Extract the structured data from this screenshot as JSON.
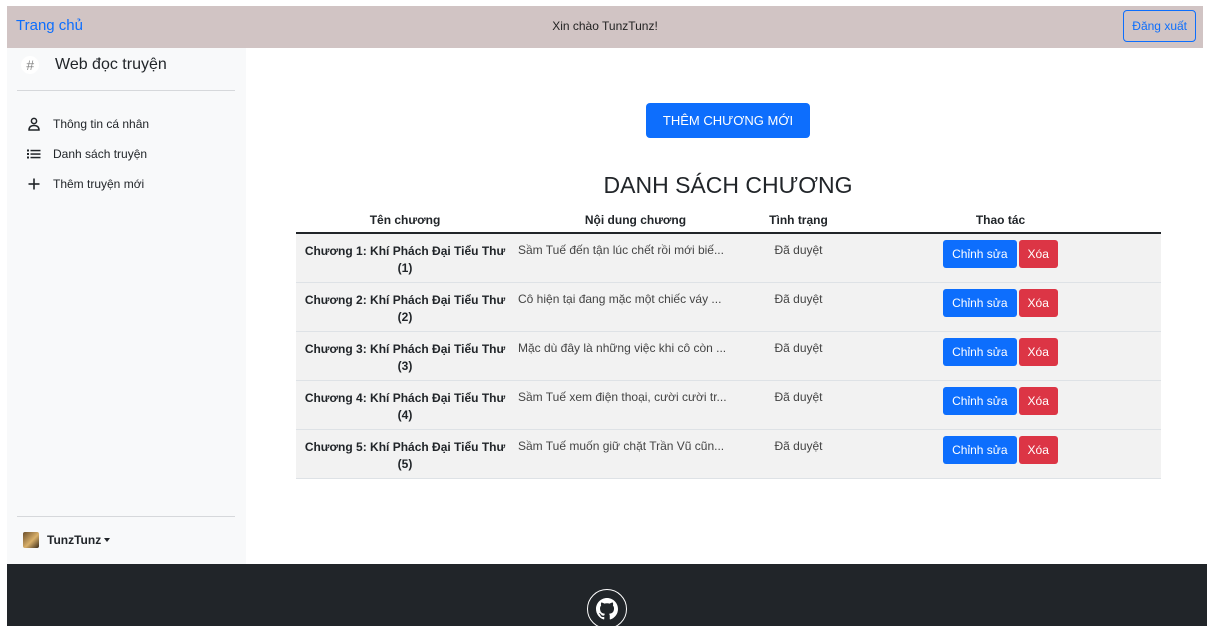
{
  "navbar": {
    "brand": "Trang chủ",
    "greeting": "Xin chào TunzTunz!",
    "logout_label": "Đăng xuất"
  },
  "sidebar": {
    "title": "Web đọc truyện",
    "items": [
      {
        "label": "Thông tin cá nhân",
        "icon": "person-icon"
      },
      {
        "label": "Danh sách truyện",
        "icon": "list-icon"
      },
      {
        "label": "Thêm truyện mới",
        "icon": "plus-icon"
      }
    ],
    "user": {
      "name": "TunzTunz"
    }
  },
  "main": {
    "add_button": "THÊM CHƯƠNG MỚI",
    "heading": "DANH SÁCH CHƯƠNG",
    "table": {
      "headers": [
        "Tên chương",
        "Nội dung chương",
        "Tình trạng",
        "Thao tác"
      ],
      "edit_label": "Chỉnh sửa",
      "delete_label": "Xóa",
      "rows": [
        {
          "name": "Chương 1: Khí Phách Đại Tiểu Thư (1)",
          "content": "Sầm Tuế đến tận lúc chết rồi mới biế...",
          "status": "Đã duyệt"
        },
        {
          "name": "Chương 2: Khí Phách Đại Tiểu Thư (2)",
          "content": "Cô hiện tại đang mặc một chiếc váy ...",
          "status": "Đã duyệt"
        },
        {
          "name": "Chương 3: Khí Phách Đại Tiểu Thư (3)",
          "content": "Mặc dù đây là những việc khi cô còn ...",
          "status": "Đã duyệt"
        },
        {
          "name": "Chương 4: Khí Phách Đại Tiểu Thư (4)",
          "content": "Sầm Tuế xem điện thoại, cười cười tr...",
          "status": "Đã duyệt"
        },
        {
          "name": "Chương 5: Khí Phách Đại Tiểu Thư (5)",
          "content": "Sầm Tuế muốn giữ chặt Trần Vũ cũn...",
          "status": "Đã duyệt"
        }
      ]
    }
  },
  "footer": {
    "icon": "github-icon"
  },
  "colors": {
    "primary": "#0d6efd",
    "danger": "#dc3545",
    "navbar_bg": "#d1c4c4",
    "footer_bg": "#212529"
  }
}
